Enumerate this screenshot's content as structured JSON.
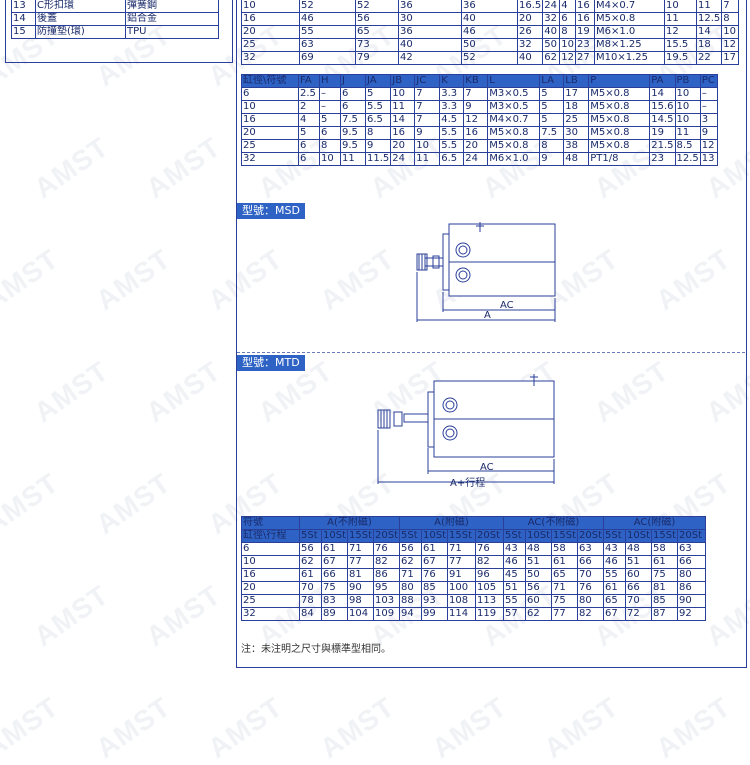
{
  "parts_table": {
    "rows": [
      [
        "13",
        "C形扣環",
        "彈簧鋼"
      ],
      [
        "14",
        "後蓋",
        "鋁合金"
      ],
      [
        "15",
        "防撞墊(環)",
        "TPU"
      ]
    ]
  },
  "table_top": {
    "rows": [
      [
        "10",
        "52",
        "52",
        "36",
        "36",
        "16.5",
        "24",
        "4",
        "16",
        "M4×0.7",
        "10",
        "11",
        "7"
      ],
      [
        "16",
        "46",
        "56",
        "30",
        "40",
        "20",
        "32",
        "6",
        "16",
        "M5×0.8",
        "11",
        "12.5",
        "8"
      ],
      [
        "20",
        "55",
        "65",
        "36",
        "46",
        "26",
        "40",
        "8",
        "19",
        "M6×1.0",
        "12",
        "14",
        "10"
      ],
      [
        "25",
        "63",
        "73",
        "40",
        "50",
        "32",
        "50",
        "10",
        "23",
        "M8×1.25",
        "15.5",
        "18",
        "12"
      ],
      [
        "32",
        "69",
        "79",
        "42",
        "52",
        "40",
        "62",
        "12",
        "27",
        "M10×1.25",
        "19.5",
        "22",
        "17"
      ]
    ]
  },
  "table_dims": {
    "headers": [
      "缸徑\\符號",
      "FA",
      "H",
      "J",
      "JA",
      "JB",
      "JC",
      "K",
      "KB",
      "L",
      "LA",
      "LB",
      "P",
      "PA",
      "PB",
      "PC"
    ],
    "rows": [
      [
        "6",
        "2.5",
        "–",
        "6",
        "5",
        "10",
        "7",
        "3.3",
        "7",
        "M3×0.5",
        "5",
        "17",
        "M5×0.8",
        "14",
        "10",
        "–"
      ],
      [
        "10",
        "2",
        "–",
        "6",
        "5.5",
        "11",
        "7",
        "3.3",
        "9",
        "M3×0.5",
        "5",
        "18",
        "M5×0.8",
        "15.6",
        "10",
        "–"
      ],
      [
        "16",
        "4",
        "5",
        "7.5",
        "6.5",
        "14",
        "7",
        "4.5",
        "12",
        "M4×0.7",
        "5",
        "25",
        "M5×0.8",
        "14.5",
        "10",
        "3"
      ],
      [
        "20",
        "5",
        "6",
        "9.5",
        "8",
        "16",
        "9",
        "5.5",
        "16",
        "M5×0.8",
        "7.5",
        "30",
        "M5×0.8",
        "19",
        "11",
        "9"
      ],
      [
        "25",
        "6",
        "8",
        "9.5",
        "9",
        "20",
        "10",
        "5.5",
        "20",
        "M5×0.8",
        "8",
        "38",
        "M5×0.8",
        "21.5",
        "8.5",
        "12"
      ],
      [
        "32",
        "6",
        "10",
        "11",
        "11.5",
        "24",
        "11",
        "6.5",
        "24",
        "M6×1.0",
        "9",
        "48",
        "PT1/8",
        "23",
        "12.5",
        "13"
      ]
    ]
  },
  "msd": {
    "label": "型號：MSD",
    "dim_ac": "AC",
    "dim_a": "A"
  },
  "mtd": {
    "label": "型號：MTD",
    "dim_ac": "AC",
    "dim_a": "A+行程"
  },
  "table_stroke": {
    "group_headers": [
      "符號",
      "A(不附磁)",
      "A(附磁)",
      "AC(不附磁)",
      "AC(附磁)"
    ],
    "sub_headers": [
      "缸徑\\行程",
      "5St",
      "10St",
      "15St",
      "20St",
      "5St",
      "10St",
      "15St",
      "20St",
      "5St",
      "10St",
      "15St",
      "20St",
      "5St",
      "10St",
      "15St",
      "20St"
    ],
    "rows": [
      [
        "6",
        "56",
        "61",
        "71",
        "76",
        "56",
        "61",
        "71",
        "76",
        "43",
        "48",
        "58",
        "63",
        "43",
        "48",
        "58",
        "63"
      ],
      [
        "10",
        "62",
        "67",
        "77",
        "82",
        "62",
        "67",
        "77",
        "82",
        "46",
        "51",
        "61",
        "66",
        "46",
        "51",
        "61",
        "66"
      ],
      [
        "16",
        "61",
        "66",
        "81",
        "86",
        "71",
        "76",
        "91",
        "96",
        "45",
        "50",
        "65",
        "70",
        "55",
        "60",
        "75",
        "80"
      ],
      [
        "20",
        "70",
        "75",
        "90",
        "95",
        "80",
        "85",
        "100",
        "105",
        "51",
        "56",
        "71",
        "76",
        "61",
        "66",
        "81",
        "86"
      ],
      [
        "25",
        "78",
        "83",
        "98",
        "103",
        "88",
        "93",
        "108",
        "113",
        "55",
        "60",
        "75",
        "80",
        "65",
        "70",
        "85",
        "90"
      ],
      [
        "32",
        "84",
        "89",
        "104",
        "109",
        "94",
        "99",
        "114",
        "119",
        "57",
        "62",
        "77",
        "82",
        "67",
        "72",
        "87",
        "92"
      ]
    ]
  },
  "note": "注：未注明之尺寸與標準型相同。",
  "watermark": "AMST",
  "colors": {
    "header_blue": "#2e62c4",
    "border": "#2a3f9a",
    "text": "#1a2a6a"
  }
}
